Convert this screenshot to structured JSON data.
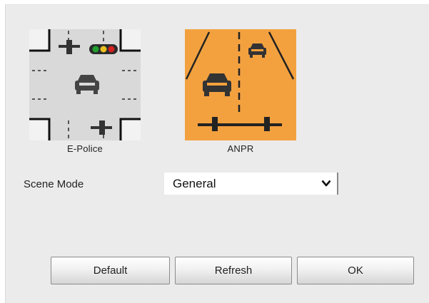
{
  "scenes": [
    {
      "id": "epolice",
      "caption": "E-Police",
      "selected": false
    },
    {
      "id": "anpr",
      "caption": "ANPR",
      "selected": true
    }
  ],
  "scene_mode": {
    "label": "Scene Mode",
    "value": "General"
  },
  "buttons": {
    "default": "Default",
    "refresh": "Refresh",
    "ok": "OK"
  },
  "colors": {
    "panel_bg": "#ebebeb",
    "selected_tile": "#f3a13f",
    "tile_road": "#d9d9d9",
    "signal_red": "#d42020",
    "signal_yellow": "#e8c020",
    "signal_green": "#20a030"
  }
}
